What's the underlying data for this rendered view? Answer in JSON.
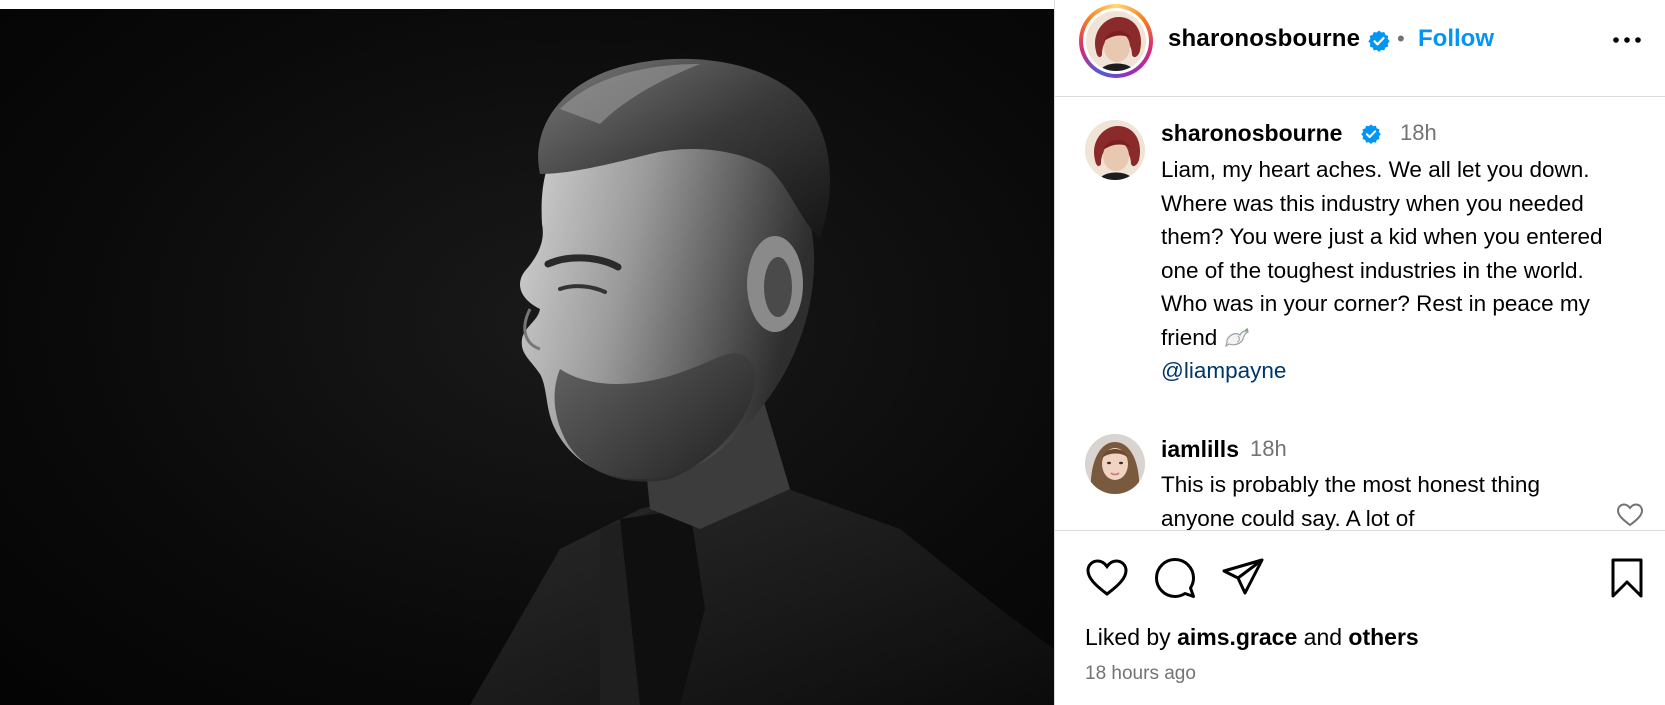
{
  "post": {
    "image_alt": "Black and white side profile portrait of a man with styled hair and beard in a dark suit",
    "author": {
      "username": "sharonosbourne",
      "verified": true,
      "follow_label": "Follow",
      "separator": "•"
    },
    "caption": {
      "username": "sharonosbourne",
      "time": "18h",
      "text": "Liam, my heart aches. We all let you down. Where was this industry when you needed them? You were just a kid when you entered one of the toughest industries in the world. Who was in your corner? Rest in peace my friend",
      "emoji_icon": "dove-icon",
      "mention": "@liampayne"
    },
    "comments": [
      {
        "username": "iamlills",
        "time": "18h",
        "text": "This is probably the most honest thing anyone could say. A lot of"
      }
    ],
    "likes": {
      "prefix": "Liked by",
      "user": "aims.grace",
      "middle": "and",
      "suffix": "others"
    },
    "posted": "18 hours ago"
  },
  "icons": {
    "verified": "verified-badge-icon",
    "more": "more-options-icon",
    "like": "heart-icon",
    "comment": "comment-icon",
    "share": "share-icon",
    "save": "bookmark-icon"
  },
  "colors": {
    "accent": "#0095f6",
    "verified": "#0095f6",
    "secondary_text": "#737373",
    "mention": "#00376b",
    "border": "#dbdbdb"
  }
}
